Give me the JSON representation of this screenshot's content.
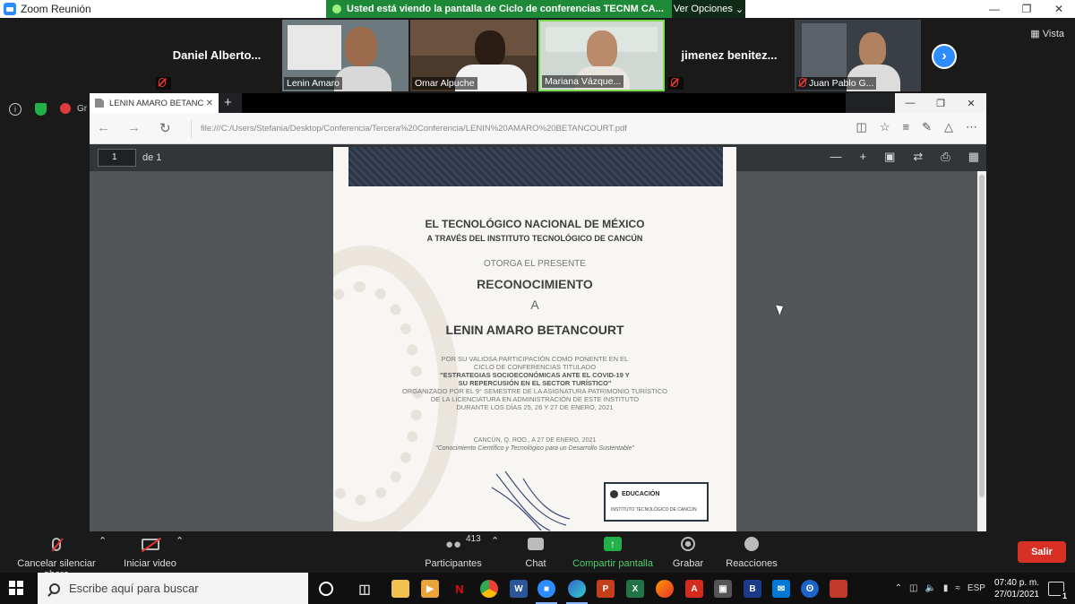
{
  "window": {
    "title": "Zoom Reunión"
  },
  "share_banner": {
    "text": "Usted está viendo la pantalla de Ciclo de conferencias TECNM CA...",
    "options": "Ver Opciones"
  },
  "gallery": {
    "vista": "Vista",
    "tiles": [
      {
        "name": "Daniel  Alberto...",
        "video": false
      },
      {
        "name": "Lenin Amaro",
        "video": true
      },
      {
        "name": "Omar Alpuche",
        "video": true
      },
      {
        "name": "Mariana Vázque...",
        "video": true
      },
      {
        "name": "jimenez  benitez...",
        "video": false
      },
      {
        "name": "Juan Pablo G...",
        "video": true
      }
    ]
  },
  "recording": {
    "label": "Gr"
  },
  "browser": {
    "tab_title": "LENIN AMARO BETANC",
    "url": "file:///C:/Users/Stefania/Desktop/Conferencia/Tercera%20Conferencia/LENIN%20AMARO%20BETANCOURT.pdf",
    "page_input": "1",
    "page_of": "de 1"
  },
  "certificate": {
    "line1": "EL TECNOLÓGICO NACIONAL DE MÉXICO",
    "line2": "A TRAVÉS DEL INSTITUTO TECNOLÓGICO DE CANCÚN",
    "otorga": "OTORGA EL PRESENTE",
    "reconocimiento": "RECONOCIMIENTO",
    "a": "A",
    "recipient": "LENIN AMARO BETANCOURT",
    "body1": "POR SU VALIOSA PARTICIPACIÓN COMO PONENTE EN EL",
    "body2": "CICLO DE CONFERENCIAS TITULADO",
    "body3": "\"ESTRATEGIAS SOCIOECONÓMICAS ANTE EL COVID-19 Y",
    "body4": "SU REPERCUSIÓN EN EL SECTOR TURÍSTICO\"",
    "body5": "ORGANIZADO POR EL 9° SEMESTRE DE LA ASIGNATURA PATRIMONIO TURÍSTICO",
    "body6": "DE LA LICENCIATURA EN ADMINISTRACIÓN DE ESTE INSTITUTO",
    "body7": "DURANTE LOS DÍAS 25, 26 Y 27 DE ENERO, 2021",
    "place": "CANCÚN, Q. ROO., A 27 DE ENERO, 2021",
    "motto": "\"Conocimiento Científico y Tecnológico para un Desarrollo Sustentable\"",
    "seal_title": "EDUCACIÓN",
    "seal_sub": "INSTITUTO TECNOLÓGICO DE CANCÚN"
  },
  "toolbar": {
    "unmute": "Cancelar silenciar ahora",
    "start_video": "Iniciar video",
    "participants_count": "413",
    "participants": "Participantes",
    "chat": "Chat",
    "share": "Compartir pantalla",
    "record": "Grabar",
    "reactions": "Reacciones",
    "leave": "Salir"
  },
  "taskbar": {
    "search_placeholder": "Escribe aquí para buscar",
    "lang": "ESP",
    "time": "07:40 p. m.",
    "date": "27/01/2021",
    "notifications": "1"
  }
}
